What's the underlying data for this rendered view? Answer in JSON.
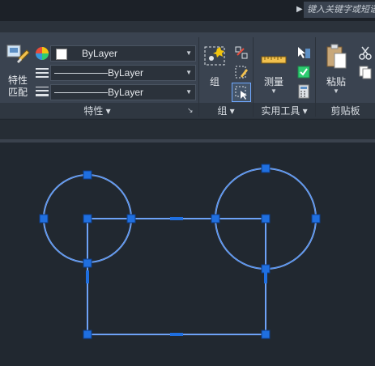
{
  "search": {
    "placeholder": "键入关键字或短语"
  },
  "properties_panel": {
    "match_button_label_line1": "特性",
    "match_button_label_line2": "匹配",
    "color_value": "ByLayer",
    "linetype_value": "ByLayer",
    "lineweight_value": "ByLayer",
    "panel_label": "特性 ▾"
  },
  "group_panel": {
    "group_button_label": "组",
    "panel_label": "组 ▾"
  },
  "utilities_panel": {
    "measure_label": "测量",
    "panel_label": "实用工具 ▾"
  },
  "clipboard_panel": {
    "paste_label": "粘贴",
    "panel_label": "剪贴板"
  },
  "colors": {
    "background": "#212830",
    "ribbon": "#3a4350",
    "geometry": "#6fa8ff",
    "grip": "#1f6fe0"
  }
}
